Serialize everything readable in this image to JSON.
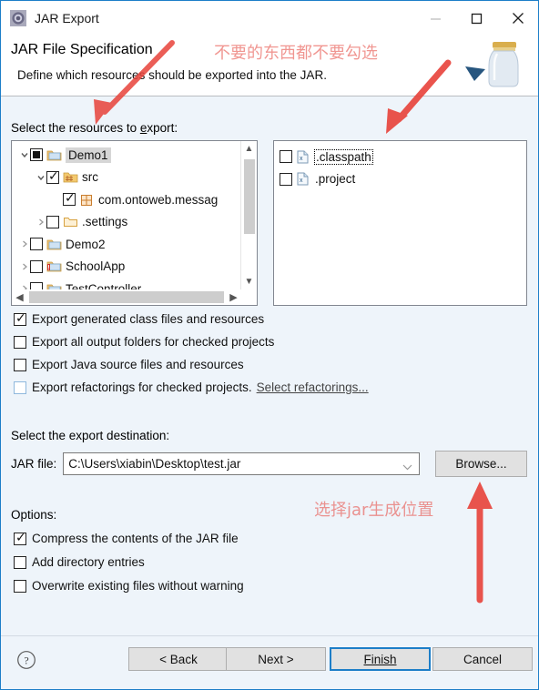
{
  "window": {
    "title": "JAR Export",
    "icon": "jar-export-icon",
    "controls": {
      "minimize": "minimize-icon",
      "maximize": "maximize-icon",
      "close": "close-icon"
    },
    "accent_color": "#1d7ec8",
    "body_background": "#eef4fa"
  },
  "header": {
    "title": "JAR File Specification",
    "subtitle": "Define which resources should be exported into the JAR.",
    "art": "jar-illustration"
  },
  "main": {
    "select_resources_label": "Select the resources to export:",
    "left_tree": [
      {
        "label": "Demo1",
        "indent": 0,
        "twisty": "down",
        "check": "partial",
        "icon": "project-folder-icon",
        "selected": true
      },
      {
        "label": "src",
        "indent": 1,
        "twisty": "down",
        "check": "checked",
        "icon": "source-folder-icon",
        "selected": false
      },
      {
        "label": "com.ontoweb.messag",
        "indent": 2,
        "twisty": "none",
        "check": "checked",
        "icon": "package-icon",
        "selected": false
      },
      {
        "label": ".settings",
        "indent": 1,
        "twisty": "right",
        "check": "unchecked",
        "icon": "folder-icon",
        "selected": false
      },
      {
        "label": "Demo2",
        "indent": 0,
        "twisty": "right",
        "check": "unchecked",
        "icon": "project-folder-icon",
        "selected": false
      },
      {
        "label": "SchoolApp",
        "indent": 0,
        "twisty": "right",
        "check": "unchecked",
        "icon": "project-folder-error-icon",
        "selected": false
      },
      {
        "label": "TestController",
        "indent": 0,
        "twisty": "right",
        "check": "unchecked",
        "icon": "project-folder-icon",
        "selected": false
      }
    ],
    "right_list": [
      {
        "label": ".classpath",
        "check": "unchecked",
        "icon": "xml-file-icon",
        "focused": true
      },
      {
        "label": ".project",
        "check": "unchecked",
        "icon": "xml-file-icon",
        "focused": false
      }
    ],
    "export_options": [
      {
        "label": "Export generated class files and resources",
        "checked": true,
        "enabled": true,
        "mnemonic": "c"
      },
      {
        "label": "Export all output folders for checked projects",
        "checked": false,
        "enabled": true,
        "mnemonic": "u"
      },
      {
        "label": "Export Java source files and resources",
        "checked": false,
        "enabled": true,
        "mnemonic": "s"
      },
      {
        "label": "Export refactorings for checked projects.",
        "checked": false,
        "enabled": false,
        "mnemonic": "x",
        "link": "Select refactorings..."
      }
    ],
    "destination_label": "Select the export destination:",
    "jar_file_label": "JAR file:",
    "jar_file_value": "C:\\Users\\xiabin\\Desktop\\test.jar",
    "browse_label": "Browse...",
    "options_label": "Options:",
    "options": [
      {
        "label": "Compress the contents of the JAR file",
        "checked": true,
        "mnemonic": "m"
      },
      {
        "label": "Add directory entries",
        "checked": false,
        "mnemonic": "d"
      },
      {
        "label": "Overwrite existing files without warning",
        "checked": false,
        "mnemonic": "O"
      }
    ]
  },
  "footer": {
    "help": "help-icon",
    "buttons": [
      {
        "label": "< Back",
        "default": false
      },
      {
        "label": "Next >",
        "default": false
      },
      {
        "label": "Finish",
        "default": true
      },
      {
        "label": "Cancel",
        "default": false
      }
    ]
  },
  "annotations": {
    "color": "#e8564f",
    "top_note": "不要的东西都不要勾选",
    "bottom_note": "选择jar生成位置"
  }
}
